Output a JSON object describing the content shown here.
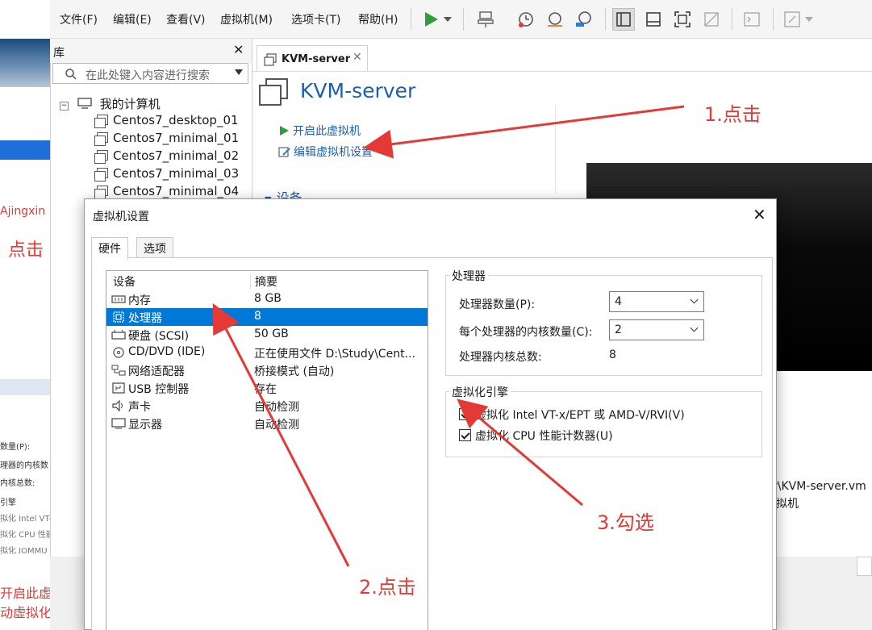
{
  "menu": [
    "文件(F)",
    "编辑(E)",
    "查看(V)",
    "虚拟机(M)",
    "选项卡(T)",
    "帮助(H)"
  ],
  "library": {
    "title": "库",
    "search_placeholder": "在此处键入内容进行搜索",
    "root": "我的计算机",
    "vms": [
      "Centos7_desktop_01",
      "Centos7_minimal_01",
      "Centos7_minimal_02",
      "Centos7_minimal_03",
      "Centos7_minimal_04"
    ]
  },
  "tab": {
    "label": "KVM-server"
  },
  "vm": {
    "title": "KVM-server",
    "action_start": "开启此虚拟机",
    "action_edit": "编辑虚拟机设置",
    "devices_section": "设备",
    "path_fragment": "r\\KVM-server.vm",
    "path_fragment2": "拟机"
  },
  "background_window": {
    "fragments": [
      "Ajingxin",
      "点击",
      "数量(P):",
      "理器的内核数",
      "内核总数:",
      "引擎",
      "拟化 Intel VT-",
      "拟化 CPU 性能",
      "拟化 IOMMU (I",
      "开启此虚拟机之",
      "动虚拟化功能"
    ]
  },
  "dialog": {
    "title": "虚拟机设置",
    "tabs": [
      "硬件",
      "选项"
    ],
    "columns": {
      "device": "设备",
      "summary": "摘要"
    },
    "devices": [
      {
        "name": "内存",
        "summary": "8 GB",
        "icon": "memory-icon"
      },
      {
        "name": "处理器",
        "summary": "8",
        "icon": "cpu-icon"
      },
      {
        "name": "硬盘 (SCSI)",
        "summary": "50 GB",
        "icon": "disk-icon"
      },
      {
        "name": "CD/DVD (IDE)",
        "summary": "正在使用文件 D:\\Study\\Cent...",
        "icon": "cd-icon"
      },
      {
        "name": "网络适配器",
        "summary": "桥接模式 (自动)",
        "icon": "network-icon"
      },
      {
        "name": "USB 控制器",
        "summary": "存在",
        "icon": "usb-icon"
      },
      {
        "name": "声卡",
        "summary": "自动检测",
        "icon": "sound-icon"
      },
      {
        "name": "显示器",
        "summary": "自动检测",
        "icon": "monitor-icon"
      }
    ],
    "processor": {
      "group_title": "处理器",
      "count_label": "处理器数量(P):",
      "count_value": "4",
      "cores_label": "每个处理器的内核数量(C):",
      "cores_value": "2",
      "total_label": "处理器内核总数:",
      "total_value": "8"
    },
    "virtualization": {
      "group_title": "虚拟化引擎",
      "opt1": "虚拟化 Intel VT-x/EPT 或 AMD-V/RVI(V)",
      "opt2": "虚拟化 CPU 性能计数器(U)"
    }
  },
  "annotations": {
    "step1": "1.点击",
    "step2": "2.点击",
    "step3": "3.勾选",
    "color": "#e53935"
  }
}
